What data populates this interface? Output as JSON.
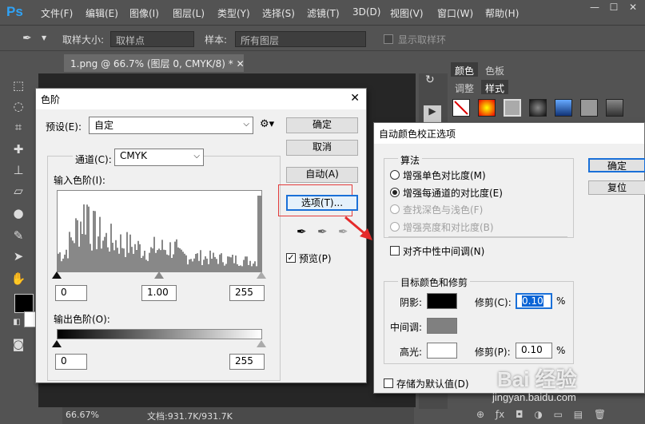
{
  "app": {
    "logo": "Ps",
    "menus": [
      "文件(F)",
      "编辑(E)",
      "图像(I)",
      "图层(L)",
      "类型(Y)",
      "选择(S)",
      "滤镜(T)",
      "3D(D)",
      "视图(V)",
      "窗口(W)",
      "帮助(H)"
    ],
    "window_controls": [
      "—",
      "☐",
      "✕"
    ]
  },
  "options_bar": {
    "sample_size_label": "取样大小:",
    "sample_size_value": "取样点",
    "sample_label": "样本:",
    "sample_value": "所有图层",
    "show_ring_label": "显示取样环"
  },
  "document": {
    "tab_title": "1.png @ 66.7% (图层 0, CMYK/8) *",
    "zoom": "66.67%",
    "doc_info": "文档:931.7K/931.7K"
  },
  "right_panel": {
    "tabs_top": [
      "颜色",
      "色板"
    ],
    "tabs_bottom": [
      "调整",
      "样式"
    ]
  },
  "levels_dialog": {
    "title": "色阶",
    "preset_label": "预设(E):",
    "preset_value": "自定",
    "channel_label": "通道(C):",
    "channel_value": "CMYK",
    "input_levels_label": "输入色阶(I):",
    "input_black": "0",
    "input_gamma": "1.00",
    "input_white": "255",
    "output_levels_label": "输出色阶(O):",
    "output_black": "0",
    "output_white": "255",
    "buttons": {
      "ok": "确定",
      "cancel": "取消",
      "auto": "自动(A)",
      "options": "选项(T)..."
    },
    "preview_label": "预览(P)",
    "preview_checked": true
  },
  "auto_color_dialog": {
    "title": "自动颜色校正选项",
    "algorithm_label": "算法",
    "options": [
      {
        "label": "增强单色对比度(M)",
        "selected": false,
        "disabled": false
      },
      {
        "label": "增强每通道的对比度(E)",
        "selected": true,
        "disabled": false
      },
      {
        "label": "查找深色与浅色(F)",
        "selected": false,
        "disabled": true
      },
      {
        "label": "增强亮度和对比度(B)",
        "selected": false,
        "disabled": true
      }
    ],
    "snap_neutral_label": "对齐中性中间调(N)",
    "target_label": "目标颜色和修剪",
    "shadows_label": "阴影:",
    "shadows_color": "#000000",
    "midtones_label": "中间调:",
    "midtones_color": "#808080",
    "highlights_label": "高光:",
    "highlights_color": "#ffffff",
    "clip_shadow_label": "修剪(C):",
    "clip_shadow_value": "0.10",
    "clip_highlight_label": "修剪(P):",
    "clip_highlight_value": "0.10",
    "percent": "%",
    "save_default_label": "存储为默认值(D)",
    "buttons": {
      "ok": "确定",
      "reset": "复位"
    }
  },
  "watermark": {
    "text": "Bai 经验",
    "url": "jingyan.baidu.com"
  }
}
